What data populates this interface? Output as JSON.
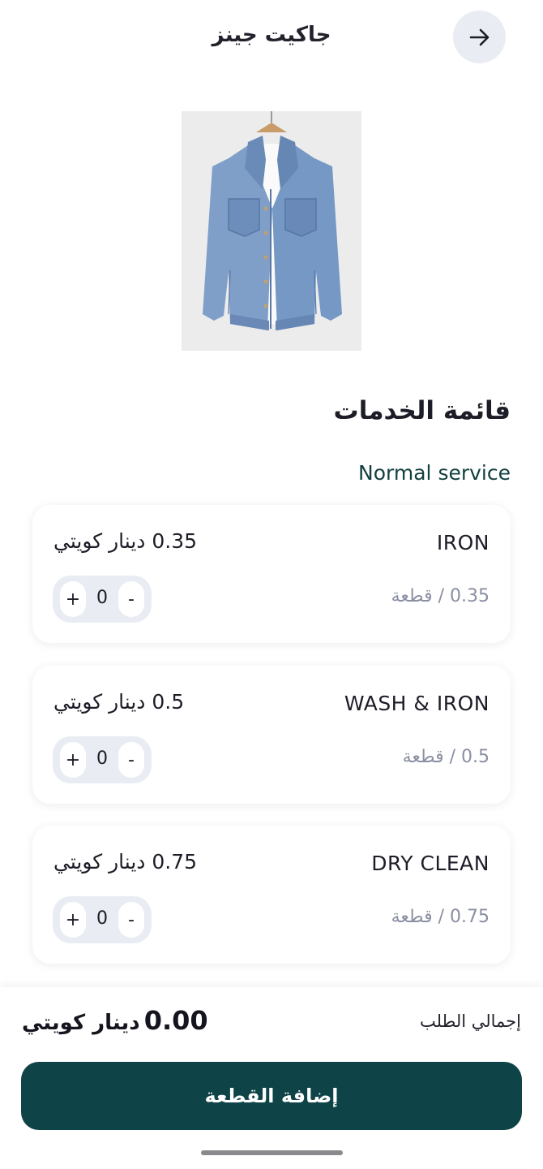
{
  "header": {
    "title": "جاكيت جينز",
    "back_icon": "arrow-right-icon"
  },
  "product": {
    "image": "denim-jacket-on-hanger"
  },
  "services": {
    "section_title": "قائمة الخدمات",
    "category": "Normal service",
    "items": [
      {
        "name": "IRON",
        "unit_price": "0.35 / قطعة",
        "price": "0.35 دينار كويتي",
        "qty": "0"
      },
      {
        "name": "WASH & IRON",
        "unit_price": "0.5 / قطعة",
        "price": "0.5 دينار كويتي",
        "qty": "0"
      },
      {
        "name": "DRY CLEAN",
        "unit_price": "0.75 / قطعة",
        "price": "0.75 دينار كويتي",
        "qty": "0"
      }
    ],
    "stepper": {
      "plus": "+",
      "minus": "-"
    }
  },
  "footer": {
    "total_label": "إجمالي الطلب",
    "total_value": "0.00",
    "currency": "دينار كويتي",
    "add_button": "إضافة القطعة"
  },
  "colors": {
    "primary": "#0e4347",
    "accent_text": "#123f40",
    "muted_text": "#8a8fa3",
    "chip_bg": "#e9edf3"
  }
}
